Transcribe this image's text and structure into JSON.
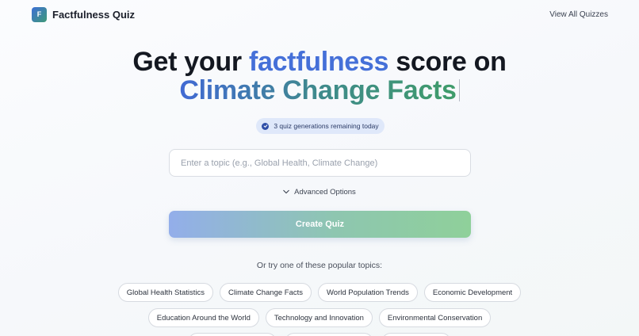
{
  "header": {
    "logo_letter": "F",
    "app_name": "Factfulness Quiz",
    "view_all_label": "View All Quizzes"
  },
  "hero": {
    "line1_prefix": "Get your ",
    "line1_accent": "factfulness",
    "line1_suffix": " score on",
    "line2_topic": "Climate Change Facts"
  },
  "badge": {
    "text": "3 quiz generations remaining today"
  },
  "topic_input": {
    "placeholder": "Enter a topic (e.g., Global Health, Climate Change)",
    "value": ""
  },
  "advanced_options_label": "Advanced Options",
  "create_button_label": "Create Quiz",
  "popular": {
    "label": "Or try one of these popular topics:",
    "row1": [
      "Global Health Statistics",
      "Climate Change Facts",
      "World Population Trends",
      "Economic Development"
    ],
    "row2": [
      "Education Around the World",
      "Technology and Innovation",
      "Environmental Conservation"
    ]
  },
  "colors": {
    "accent_blue": "#4570d8",
    "accent_green": "#3f9c6a",
    "badge_bg": "#dfe8fa"
  }
}
